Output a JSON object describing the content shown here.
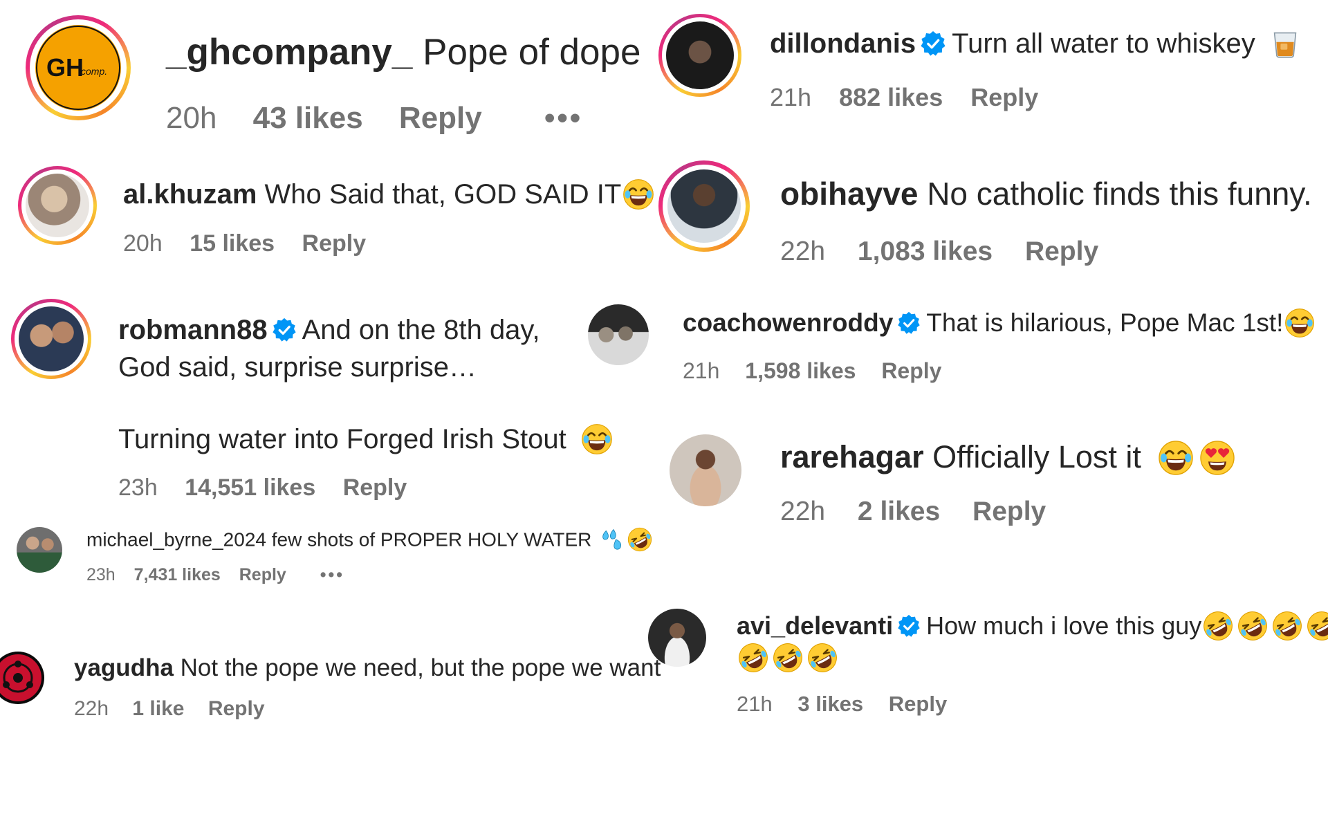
{
  "colors": {
    "text": "#262626",
    "meta": "#737373",
    "verified": "#0095f6",
    "ring_start": "#f9ce34",
    "ring_end": "#ee2a7b"
  },
  "comments": [
    {
      "username": "_ghcompany_",
      "text": "Pope of dope",
      "time": "20h",
      "likes": "43 likes",
      "reply": "Reply",
      "more": "•••",
      "avatar_text": "GH company",
      "verified": false
    },
    {
      "username": "dillondanis",
      "text": "Turn all water to whiskey",
      "time": "21h",
      "likes": "882 likes",
      "reply": "Reply",
      "verified": true,
      "emoji": "whiskey-glass"
    },
    {
      "username": "al.khuzam",
      "text": "Who Said that, GOD SAID IT",
      "time": "20h",
      "likes": "15 likes",
      "reply": "Reply",
      "verified": false,
      "emoji": "laughing"
    },
    {
      "username": "obihayve",
      "text": "No catholic finds this funny.",
      "time": "22h",
      "likes": "1,083 likes",
      "reply": "Reply",
      "verified": false
    },
    {
      "username": "robmann88",
      "text_line1": "And on the 8th day,",
      "text_line2": "God said, surprise surprise…",
      "text_line3": "Turning water into Forged Irish Stout",
      "time": "23h",
      "likes": "14,551 likes",
      "reply": "Reply",
      "verified": true,
      "emoji": "laughing"
    },
    {
      "username": "coachowenroddy",
      "text": "That is hilarious, Pope Mac 1st!",
      "time": "21h",
      "likes": "1,598 likes",
      "reply": "Reply",
      "verified": true,
      "emoji": "laughing"
    },
    {
      "username": "rarehagar",
      "text": "Officially Lost it",
      "time": "22h",
      "likes": "2 likes",
      "reply": "Reply",
      "verified": false,
      "emojis": [
        "laughing",
        "heart-eyes"
      ]
    },
    {
      "username": "michael_byrne_2024",
      "text": "few shots of PROPER HOLY WATER",
      "time": "23h",
      "likes": "7,431 likes",
      "reply": "Reply",
      "more": "•••",
      "verified": false,
      "emojis": [
        "sweat-droplets",
        "rofl"
      ]
    },
    {
      "username": "avi_delevanti",
      "text": "How much i love this guy",
      "time": "21h",
      "likes": "3 likes",
      "reply": "Reply",
      "verified": true,
      "emojis": [
        "rofl",
        "rofl",
        "rofl",
        "rofl",
        "rofl",
        "rofl",
        "rofl"
      ]
    },
    {
      "username": "yagudha",
      "text": "Not the pope we need, but the pope we want",
      "time": "22h",
      "likes": "1 like",
      "reply": "Reply",
      "verified": false
    }
  ]
}
